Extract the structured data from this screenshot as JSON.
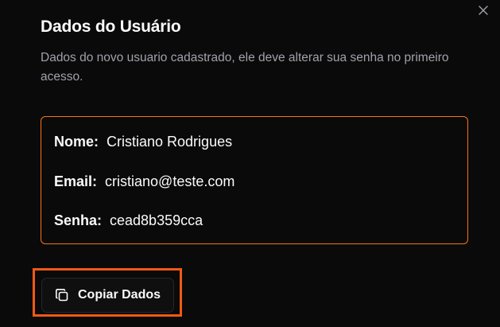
{
  "dialog": {
    "title": "Dados do Usuário",
    "description": "Dados do novo usuario cadastrado, ele deve alterar sua senha no primeiro acesso.",
    "close_icon": "close-icon"
  },
  "user_info": {
    "name_label": "Nome:",
    "name_value": "Cristiano Rodrigues",
    "email_label": "Email:",
    "email_value": "cristiano@teste.com",
    "password_label": "Senha:",
    "password_value": "cead8b359cca"
  },
  "actions": {
    "copy_label": "Copiar Dados",
    "copy_icon": "copy-icon"
  },
  "colors": {
    "accent": "#f97316",
    "highlight": "#f05a14",
    "background": "#0a0a0a",
    "text": "#fafafa",
    "muted_text": "#a1a1aa"
  }
}
